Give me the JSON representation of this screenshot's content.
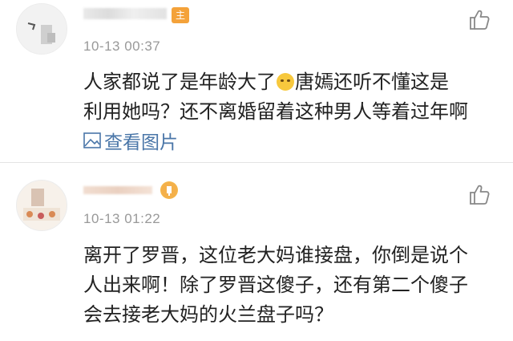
{
  "comments": [
    {
      "timestamp": "10-13 00:37",
      "owner_badge": "主",
      "lines": [
        "人家都说了是年龄大了",
        "唐嫣还听不懂这是",
        "利用她吗？还不离婚留着这种男人等着过年啊"
      ],
      "emoji_icon": "shush-face-emoji",
      "view_image_label": "查看图片"
    },
    {
      "timestamp": "10-13 01:22",
      "lines": [
        "离开了罗晋，这位老大妈谁接盘，你倒是说个",
        "人出来啊！除了罗晋这傻子，还有第二个傻子",
        "会去接老大妈的火兰盘子吗？"
      ]
    }
  ],
  "icons": {
    "like": "thumbs-up-icon",
    "image": "image-icon",
    "accent_color": "#4a76a8",
    "badge_color": "#f4a23a"
  }
}
